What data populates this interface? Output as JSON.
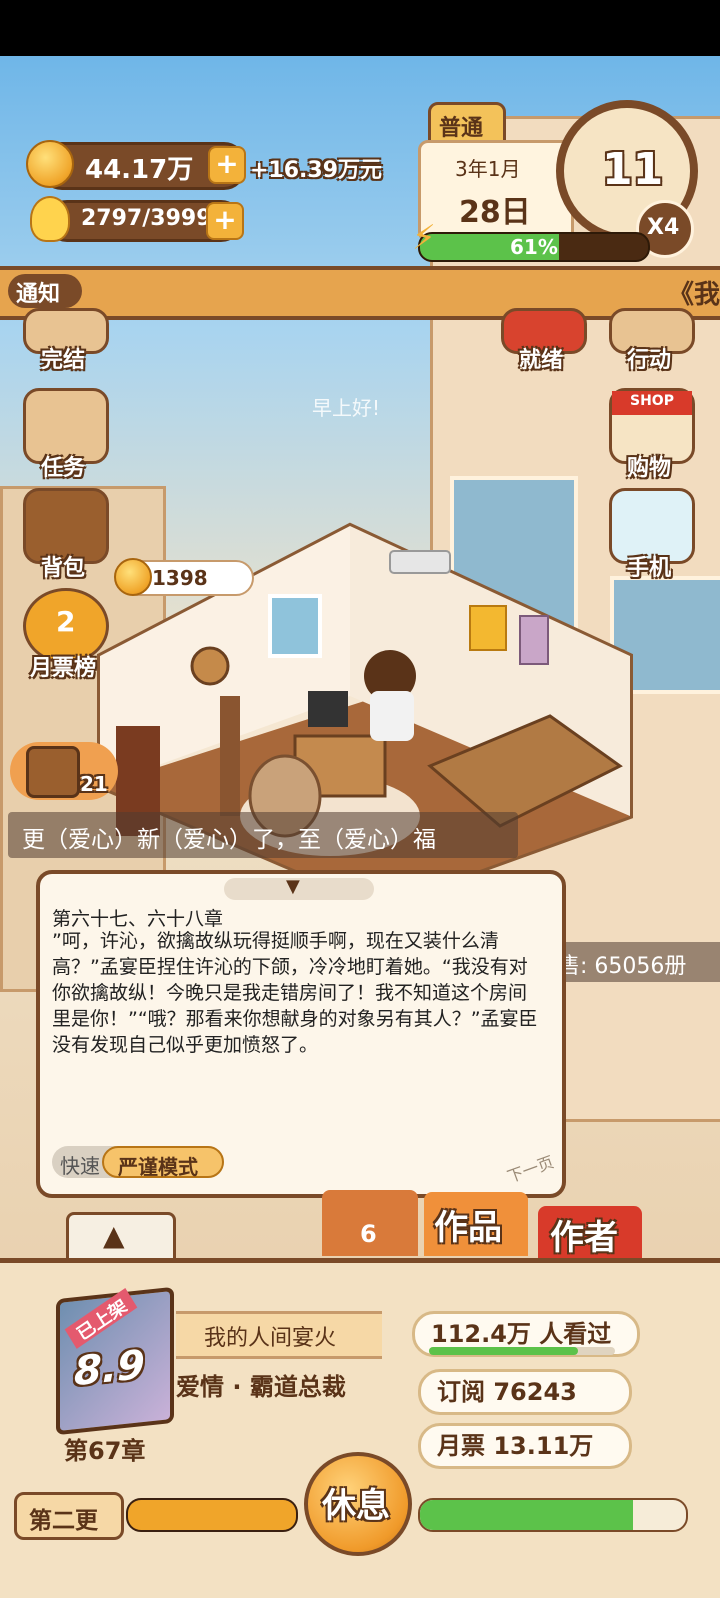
{
  "colors": {
    "accent": "#f3b23a",
    "brown": "#7a4a28",
    "green": "#5cc24a",
    "red": "#d83a2a",
    "dialog_bg": "#fdf6ea"
  },
  "top": {
    "coins": "44.17万",
    "income": "+16.39万元",
    "energy": "2797/3999",
    "difficulty": "普通",
    "date": "3年1月",
    "day": "28日",
    "clock_hour": "11",
    "speed": "X4",
    "progress_label": "61%",
    "progress": 0.61
  },
  "notice": {
    "label": "通知",
    "text": "《我"
  },
  "left_menu": [
    {
      "name": "complete",
      "label": "完结"
    },
    {
      "name": "tasks",
      "label": "任务"
    },
    {
      "name": "backpack",
      "label": "背包"
    },
    {
      "name": "monthly-ticket-rank",
      "label": "月票榜",
      "badge": "2"
    }
  ],
  "right_menu": [
    {
      "name": "ready",
      "label": "就绪"
    },
    {
      "name": "action",
      "label": "行动"
    },
    {
      "name": "shop",
      "label": "购物",
      "sign": "SHOP"
    },
    {
      "name": "phone",
      "label": "手机"
    }
  ],
  "scene": {
    "greeting": "早上好!",
    "bubble_coins": "1398",
    "chest_count": "21",
    "update_banner": "更（爱心）新（爱心）了，至（爱心）福",
    "sales_text": "售: 65056册"
  },
  "dialog": {
    "chapter_title": "第六十七、六十八章",
    "body": "”呵，许沁，欲擒故纵玩得挺顺手啊，现在又装什么清高？”孟宴臣捏住许沁的下颌，冷冷地盯着她。“我没有对你欲擒故纵！今晚只是我走错房间了！我不知道这个房间里是你！”“哦？那看来你想献身的对象另有其人？”孟宴臣没有发现自己似乎更加愤怒了。",
    "mode_fast": "快速",
    "mode_strict": "严谨模式",
    "next_page": "下一页"
  },
  "tabs": {
    "interact_count": "6",
    "works": "作品",
    "author": "作者"
  },
  "book": {
    "status": "已上架",
    "score": "8.9",
    "chapter": "第67章",
    "title": "我的人间宴火",
    "genre": "爱情 · 霸道总裁",
    "views": "112.4万  人看过",
    "views_progress": 0.8,
    "subscriptions": "订阅  76243",
    "monthly_tickets": "月票  13.11万"
  },
  "footer": {
    "update_label": "第二更",
    "rest_button": "休息",
    "left_progress": 1.0,
    "right_progress": 0.8
  }
}
